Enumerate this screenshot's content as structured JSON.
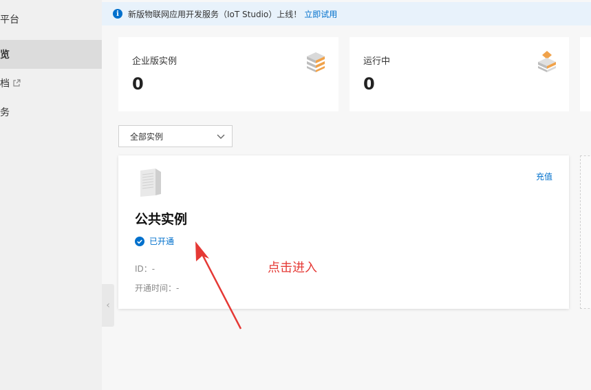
{
  "sidebar": {
    "title": "平台",
    "items": [
      {
        "label": "览",
        "active": true
      },
      {
        "label": "档",
        "external": true
      },
      {
        "label": "务"
      }
    ]
  },
  "notice": {
    "text": "新版物联网应用开发服务（IoT Studio）上线！",
    "link": "立即试用"
  },
  "stats": [
    {
      "label": "企业版实例",
      "value": "0",
      "icon": "stack-layers-icon"
    },
    {
      "label": "运行中",
      "value": "0",
      "icon": "running-stack-icon"
    }
  ],
  "filter": {
    "selected": "全部实例"
  },
  "instance": {
    "title": "公共实例",
    "action": "充值",
    "status": "已开通",
    "id_label": "ID：-",
    "open_time_label": "开通时间：-"
  },
  "annotation": {
    "text": "点击进入",
    "color": "#e53935"
  },
  "colors": {
    "accent": "#0070cc",
    "notice_bg": "#e8f2fb"
  }
}
